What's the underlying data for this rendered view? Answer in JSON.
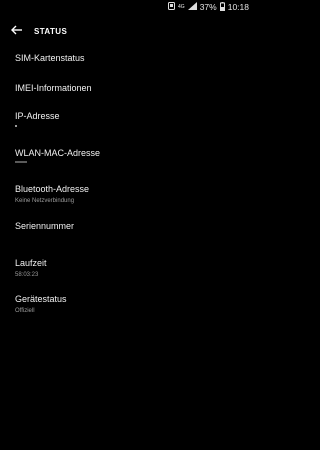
{
  "status_bar": {
    "signal_label": "4G",
    "battery": "37%",
    "time": "10:18"
  },
  "header": {
    "title": "STATUS"
  },
  "items": [
    {
      "title": "SIM-Kartenstatus",
      "subtitle": ""
    },
    {
      "title": "IMEI-Informationen",
      "subtitle": ""
    },
    {
      "title": "IP-Adresse",
      "subtitle": ""
    },
    {
      "title": "WLAN-MAC-Adresse",
      "subtitle": ""
    },
    {
      "title": "Bluetooth-Adresse",
      "subtitle": "Keine Netzverbindung"
    },
    {
      "title": "Seriennummer",
      "subtitle": ""
    },
    {
      "title": "Laufzeit",
      "subtitle": "58:03:23"
    },
    {
      "title": "Gerätestatus",
      "subtitle": "Offiziell"
    }
  ]
}
